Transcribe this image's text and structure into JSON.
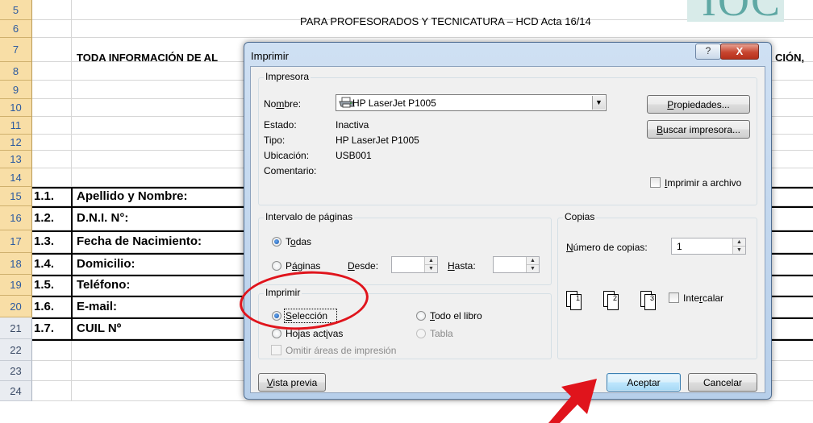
{
  "sheet": {
    "header_title": "PARA PROFESORADOS  Y TECNICATURA – HCD Acta 16/14",
    "info_left": "TODA INFORMACIÓN DE AL",
    "info_right": "CIÓN,",
    "logo_text": "IOC",
    "rows": [
      {
        "n": "5"
      },
      {
        "n": "6"
      },
      {
        "n": "7"
      },
      {
        "n": "8"
      },
      {
        "n": "9"
      },
      {
        "n": "10"
      },
      {
        "n": "11"
      },
      {
        "n": "12"
      },
      {
        "n": "13"
      },
      {
        "n": "14"
      },
      {
        "n": "15"
      },
      {
        "n": "16"
      },
      {
        "n": "17"
      },
      {
        "n": "18"
      },
      {
        "n": "19"
      },
      {
        "n": "20"
      },
      {
        "n": "21"
      },
      {
        "n": "22"
      },
      {
        "n": "23"
      },
      {
        "n": "24"
      }
    ],
    "fields": [
      {
        "num": "1.1.",
        "label": "Apellido y Nombre:"
      },
      {
        "num": "1.2.",
        "label": "D.N.I. N°:"
      },
      {
        "num": "1.3.",
        "label": "Fecha de Nacimiento:"
      },
      {
        "num": "1.4.",
        "label": "Domicilio:"
      },
      {
        "num": "1.5.",
        "label": "Teléfono:"
      },
      {
        "num": "1.6.",
        "label": "E-mail:"
      },
      {
        "num": "1.7.",
        "label": "CUIL Nº"
      }
    ]
  },
  "dialog": {
    "title": "Imprimir",
    "help_label": "?",
    "close_label": "X",
    "printer": {
      "group_label": "Impresora",
      "name_label": "Nombre:",
      "name_value": "HP LaserJet P1005",
      "status_label": "Estado:",
      "status_value": "Inactiva",
      "type_label": "Tipo:",
      "type_value": "HP LaserJet P1005",
      "location_label": "Ubicación:",
      "location_value": "USB001",
      "comment_label": "Comentario:",
      "properties_button": "Propiedades...",
      "find_button": "Buscar impresora...",
      "print_to_file": "Imprimir a archivo"
    },
    "range": {
      "group_label": "Intervalo de páginas",
      "all_label": "Todas",
      "pages_label": "Páginas",
      "from_label": "Desde:",
      "to_label": "Hasta:",
      "from_value": "",
      "to_value": ""
    },
    "print_what": {
      "group_label": "Imprimir",
      "selection_label": "Selección",
      "active_sheets_label": "Hojas activas",
      "workbook_label": "Todo el libro",
      "table_label": "Tabla",
      "ignore_areas_label": "Omitir áreas de impresión"
    },
    "copies": {
      "group_label": "Copias",
      "count_label": "Número de copias:",
      "count_value": "1",
      "collate_label": "Intercalar"
    },
    "preview_button": "Vista previa",
    "ok_button": "Aceptar",
    "cancel_button": "Cancelar"
  },
  "colors": {
    "annotation_red": "#e0141c",
    "row_header_selected": "#f8dea6",
    "dialog_frame": "#b7cfea"
  },
  "icons": [
    "printer-icon",
    "dropdown-arrow-icon",
    "spin-up-icon",
    "spin-down-icon",
    "collate-pages-icon",
    "red-arrow-icon"
  ]
}
